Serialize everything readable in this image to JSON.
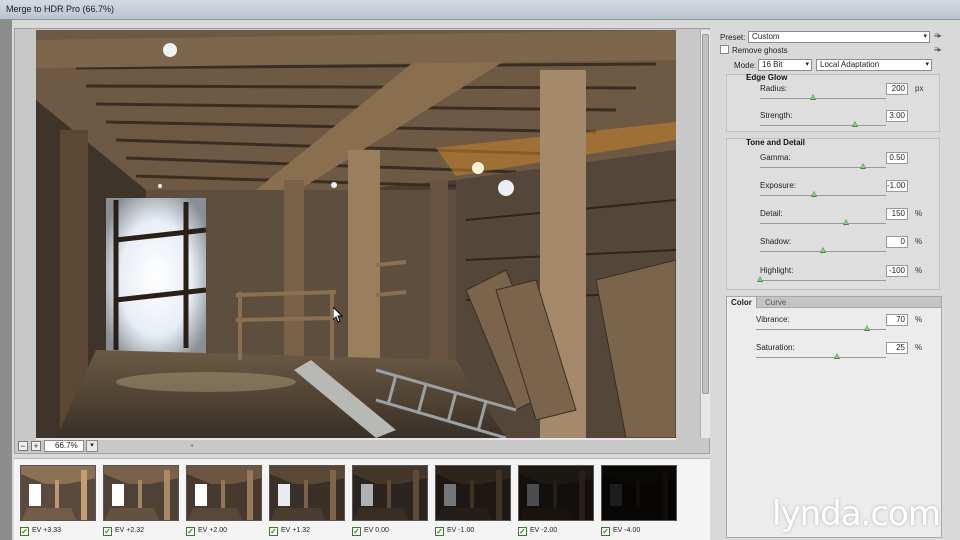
{
  "window": {
    "title": "Merge to HDR Pro (66.7%)"
  },
  "zoom": {
    "minus": "−",
    "plus": "+",
    "value": "66.7%",
    "dropdown": "▾"
  },
  "thumbnails": [
    {
      "label": "EV +3.33",
      "brightness": 1.55,
      "checked": true
    },
    {
      "label": "EV +2.32",
      "brightness": 1.35,
      "checked": true
    },
    {
      "label": "EV +2.00",
      "brightness": 1.2,
      "checked": true
    },
    {
      "label": "EV +1.32",
      "brightness": 1.0,
      "checked": true
    },
    {
      "label": "EV 0.00",
      "brightness": 0.75,
      "checked": true
    },
    {
      "label": "EV -1.00",
      "brightness": 0.5,
      "checked": true
    },
    {
      "label": "EV -2.00",
      "brightness": 0.32,
      "checked": true
    },
    {
      "label": "EV -4.00",
      "brightness": 0.12,
      "checked": true
    }
  ],
  "panel": {
    "preset_label": "Preset:",
    "preset_value": "Custom",
    "remove_ghosts_label": "Remove ghosts",
    "mode_label": "Mode:",
    "mode_value": "16 Bit",
    "method_value": "Local Adaptation",
    "edge_glow": {
      "title": "Edge Glow",
      "radius": {
        "label": "Radius:",
        "value": "200",
        "unit": "px",
        "fraction": 0.42
      },
      "strength": {
        "label": "Strength:",
        "value": "3.00",
        "unit": "",
        "fraction": 0.75
      }
    },
    "tone_detail": {
      "title": "Tone and Detail",
      "gamma": {
        "label": "Gamma:",
        "value": "0.50",
        "unit": "",
        "fraction": 0.82
      },
      "exposure": {
        "label": "Exposure:",
        "value": "-1.00",
        "unit": "",
        "fraction": 0.43
      },
      "detail": {
        "label": "Detail:",
        "value": "150",
        "unit": "%",
        "fraction": 0.68
      },
      "shadow": {
        "label": "Shadow:",
        "value": "0",
        "unit": "%",
        "fraction": 0.5
      },
      "highlight": {
        "label": "Highlight:",
        "value": "-100",
        "unit": "%",
        "fraction": 0.0
      }
    },
    "tabs": {
      "color": "Color",
      "curve": "Curve"
    },
    "color": {
      "vibrance": {
        "label": "Vibrance:",
        "value": "70",
        "unit": "%",
        "fraction": 0.85
      },
      "saturation": {
        "label": "Saturation:",
        "value": "25",
        "unit": "%",
        "fraction": 0.62
      }
    }
  },
  "watermark": "lynda.com"
}
